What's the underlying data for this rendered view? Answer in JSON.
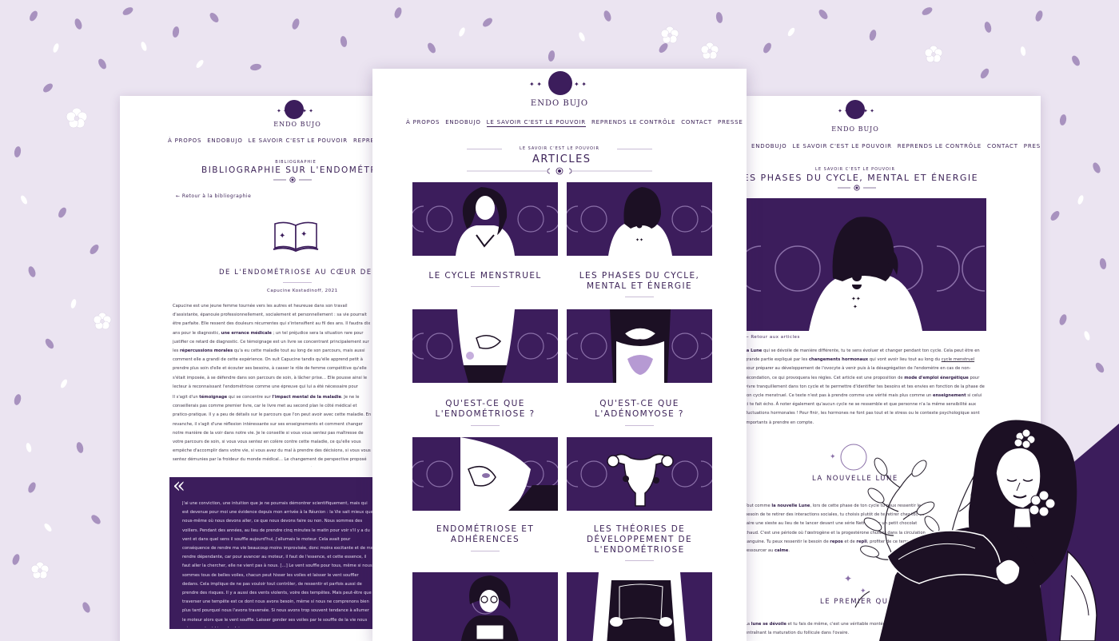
{
  "site": {
    "logo_text": "ENDO BUJO"
  },
  "nav": {
    "items": [
      "À PROPOS",
      "ENDOBUJO",
      "LE SAVOIR C'EST LE POUVOIR",
      "REPRENDS LE CONTRÔLE",
      "CONTACT",
      "PRESSE"
    ],
    "active_index": 2
  },
  "left_page": {
    "kicker": "BIBLIOGRAPHIE",
    "title": "BIBLIOGRAPHIE SUR L'ENDOMÉTRIOSE",
    "back_link": "← Retour à la bibliographie",
    "book_title": "DE L'ENDOMÉTRIOSE AU CŒUR DE SOI",
    "author": "Capucine Kostadinoff, 2021",
    "quote_mark": "«"
  },
  "center_page": {
    "kicker": "LE SAVOIR C'EST LE POUVOIR",
    "title": "ARTICLES",
    "articles": [
      {
        "title": "LE CYCLE MENSTRUEL",
        "image_icon": "woman-hands-chest-illustration"
      },
      {
        "title": "LES PHASES DU CYCLE, MENTAL ET ÉNERGIE",
        "image_icon": "woman-back-moon-tattoo-illustration"
      },
      {
        "title": "QU'EST-CE QUE L'ENDOMÉTRIOSE ?",
        "image_icon": "belly-pain-illustration"
      },
      {
        "title": "QU'EST-CE QUE L'ADÉNOMYOSE ?",
        "image_icon": "hands-uterus-illustration"
      },
      {
        "title": "ENDOMÉTRIOSE ET ADHÉRENCES",
        "image_icon": "belly-touch-illustration"
      },
      {
        "title": "LES THÉORIES DE DÉVELOPPEMENT DE L'ENDOMÉTRIOSE",
        "image_icon": "uterus-illustration"
      },
      {
        "title": "",
        "image_icon": "woman-glasses-reading-illustration"
      },
      {
        "title": "",
        "image_icon": "hands-book-illustration"
      }
    ]
  },
  "right_page": {
    "kicker": "LE SAVOIR C'EST LE POUVOIR",
    "title": "LES PHASES DU CYCLE, MENTAL ET ÉNERGIE",
    "back_link": "← Retour aux articles",
    "section_new_moon": "LA NOUVELLE LUNE",
    "section_first_quarter": "LE PREMIER QUARTIER",
    "link_cycle": "cycle menstruel"
  },
  "colors": {
    "accent": "#3c1d5c",
    "background": "#ebe4f1",
    "text": "#3d2358"
  }
}
